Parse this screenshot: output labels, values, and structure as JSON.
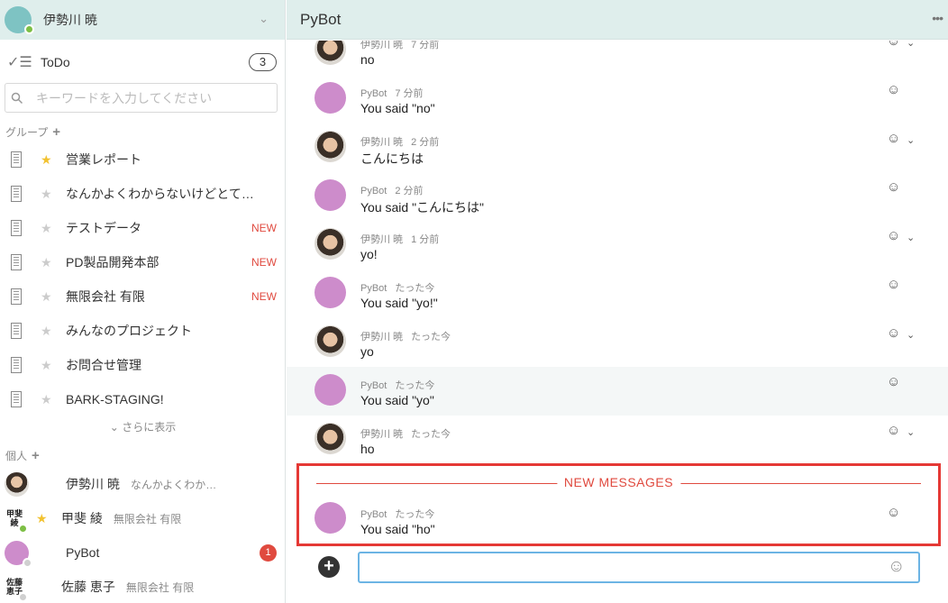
{
  "sidebar": {
    "user_name": "伊勢川 暁",
    "todo": {
      "label": "ToDo",
      "count": "3"
    },
    "search": {
      "placeholder": "キーワードを入力してください"
    },
    "groups_header": "グループ",
    "groups": [
      {
        "label": "営業レポート",
        "favorite": true,
        "badge": ""
      },
      {
        "label": "なんかよくわからないけどとて…",
        "favorite": false,
        "badge": ""
      },
      {
        "label": "テストデータ",
        "favorite": false,
        "badge": "NEW"
      },
      {
        "label": "PD製品開発本部",
        "favorite": false,
        "badge": "NEW"
      },
      {
        "label": "無限会社 有限",
        "favorite": false,
        "badge": "NEW"
      },
      {
        "label": "みんなのプロジェクト",
        "favorite": false,
        "badge": ""
      },
      {
        "label": "お問合せ管理",
        "favorite": false,
        "badge": ""
      },
      {
        "label": "BARK-STAGING!",
        "favorite": false,
        "badge": ""
      }
    ],
    "show_more": "さらに表示",
    "people_header": "個人",
    "people": [
      {
        "name": "伊勢川 暁",
        "sub": "なんかよくわか…",
        "avatar": "photo",
        "status": "none",
        "favorite": false,
        "unread": ""
      },
      {
        "name": "甲斐 綾",
        "sub": "無限会社 有限",
        "avatar": "kanji",
        "avatar_text": "甲斐綾",
        "status": "online",
        "favorite": true,
        "unread": ""
      },
      {
        "name": "PyBot",
        "sub": "",
        "avatar": "purple",
        "status": "offline",
        "favorite": false,
        "unread": "1"
      },
      {
        "name": "佐藤 恵子",
        "sub": "無限会社 有限",
        "avatar": "kanji",
        "avatar_text": "佐藤恵子",
        "status": "offline",
        "favorite": false,
        "unread": ""
      }
    ]
  },
  "main": {
    "title": "PyBot",
    "messages": [
      {
        "sender": "伊勢川 暁",
        "ago": "7 分前",
        "text": "no",
        "avatar": "photo",
        "own": true
      },
      {
        "sender": "PyBot",
        "ago": "7 分前",
        "text": "You said \"no\"",
        "avatar": "purple",
        "own": false
      },
      {
        "sender": "伊勢川 暁",
        "ago": "2 分前",
        "text": "こんにちは",
        "avatar": "photo",
        "own": true
      },
      {
        "sender": "PyBot",
        "ago": "2 分前",
        "text": "You said \"こんにちは\"",
        "avatar": "purple",
        "own": false
      },
      {
        "sender": "伊勢川 暁",
        "ago": "1 分前",
        "text": "yo!",
        "avatar": "photo",
        "own": true
      },
      {
        "sender": "PyBot",
        "ago": "たった今",
        "text": "You said \"yo!\"",
        "avatar": "purple",
        "own": false
      },
      {
        "sender": "伊勢川 暁",
        "ago": "たった今",
        "text": "yo",
        "avatar": "photo",
        "own": true
      },
      {
        "sender": "PyBot",
        "ago": "たった今",
        "text": "You said \"yo\"",
        "avatar": "purple",
        "own": false,
        "highlight": true
      },
      {
        "sender": "伊勢川 暁",
        "ago": "たった今",
        "text": "ho",
        "avatar": "photo",
        "own": true
      }
    ],
    "new_messages_label": "NEW MESSAGES",
    "new_message": {
      "sender": "PyBot",
      "ago": "たった今",
      "text": "You said \"ho\"",
      "avatar": "purple"
    },
    "composer": {
      "value": ""
    }
  },
  "colors": {
    "header_bg": "#dfeeec",
    "accent_red": "#e04a3f",
    "bot_purple": "#cd8ccb",
    "input_focus": "#6cb4e4"
  }
}
